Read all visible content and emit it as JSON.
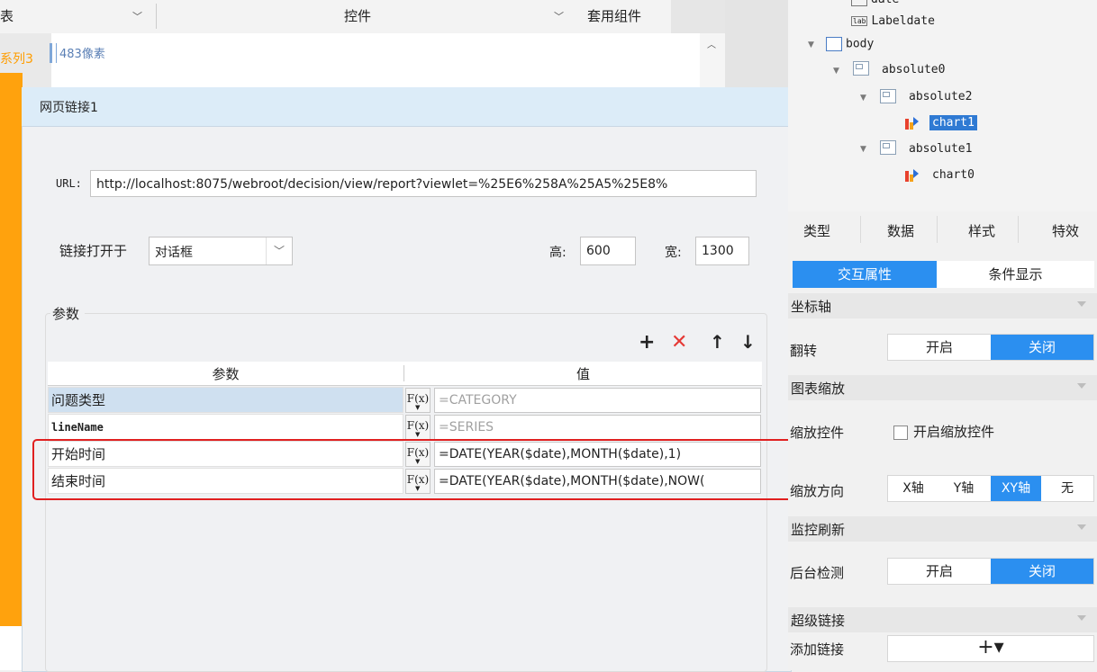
{
  "top_bar": {
    "left_fragment": "表",
    "widget_label": "控件",
    "template_label": "套用组件"
  },
  "canvas": {
    "series_label": "系列3",
    "ruler_text": "483像素"
  },
  "dialog": {
    "title": "网页链接1",
    "url_label": "URL:",
    "url_value": "http://localhost:8075/webroot/decision/view/report?viewlet=%25E6%258A%25A5%25E8%",
    "open_in_label": "链接打开于",
    "open_in_value": "对话框",
    "height_label": "高:",
    "height_value": "600",
    "width_label": "宽:",
    "width_value": "1300",
    "params_group_label": "参数",
    "toolbar": {
      "add": "+",
      "delete": "✕",
      "up": "↑",
      "down": "↓"
    },
    "table": {
      "col_param": "参数",
      "col_value": "值",
      "fx_label": "F(x)",
      "rows": [
        {
          "name": "问题类型",
          "value": "=CATEGORY"
        },
        {
          "name": "lineName",
          "value": "=SERIES"
        },
        {
          "name": "开始时间",
          "value": "=DATE(YEAR($date),MONTH($date),1)"
        },
        {
          "name": "结束时间",
          "value": "=DATE(YEAR($date),MONTH($date),NOW("
        }
      ]
    }
  },
  "tree": {
    "nodes": [
      "date",
      "Labeldate",
      "body",
      "absolute0",
      "absolute2",
      "chart1",
      "absolute1",
      "chart0"
    ]
  },
  "right_panel": {
    "tabs": [
      "类型",
      "数据",
      "样式",
      "特效"
    ],
    "subtabs": [
      "交互属性",
      "条件显示"
    ],
    "sections": {
      "axis": "坐标轴",
      "chart_zoom": "图表缩放",
      "monitor": "监控刷新",
      "hyperlink": "超级链接"
    },
    "flip_label": "翻转",
    "on": "开启",
    "off": "关闭",
    "zoom_control_label": "缩放控件",
    "zoom_control_check": "开启缩放控件",
    "zoom_dir_label": "缩放方向",
    "zoom_dirs": [
      "X轴",
      "Y轴",
      "XY轴",
      "无"
    ],
    "backend_label": "后台检测",
    "add_link_label": "添加链接",
    "add_link_button": "+▾"
  },
  "colors": {
    "accent": "#2b8ff0",
    "orange": "#ffa20d",
    "highlight_red": "#e02020",
    "title_bar": "#dcecf8"
  }
}
